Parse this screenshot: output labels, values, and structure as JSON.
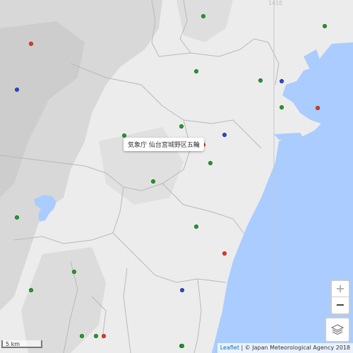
{
  "map": {
    "tooltip": "気象庁 仙台宮城野区五輪",
    "grid_label": "141E",
    "scale_label": "5 km",
    "attribution_link": "Leaflet",
    "attribution_sep": " | ",
    "attribution_text": "© Japan Meteorological Agency 2018",
    "zoom_in": "+",
    "zoom_out": "−",
    "colors": {
      "land": "#ececec",
      "land_dark": "#d6d6d6",
      "land_darker": "#cbcbcb",
      "sea": "#aaccff",
      "lake": "#aaccff",
      "boundary": "#b9b9b9",
      "marker_green": "#1fa12a",
      "marker_red": "#ee3b1c",
      "marker_blue": "#2c48d6"
    },
    "markers": [
      {
        "color": "green"
      },
      {
        "color": "red"
      },
      {
        "color": "green"
      },
      {
        "color": "blue"
      },
      {
        "color": "green"
      },
      {
        "color": "blue"
      },
      {
        "color": "green"
      },
      {
        "color": "green"
      },
      {
        "color": "red"
      },
      {
        "color": "green"
      },
      {
        "color": "green"
      },
      {
        "color": "blue"
      },
      {
        "color": "green"
      },
      {
        "color": "red"
      },
      {
        "color": "green"
      },
      {
        "color": "green"
      },
      {
        "color": "green"
      },
      {
        "color": "green"
      },
      {
        "color": "green"
      },
      {
        "color": "red"
      },
      {
        "color": "green"
      },
      {
        "color": "green"
      },
      {
        "color": "blue"
      },
      {
        "color": "green"
      },
      {
        "color": "red"
      },
      {
        "color": "green"
      }
    ]
  }
}
